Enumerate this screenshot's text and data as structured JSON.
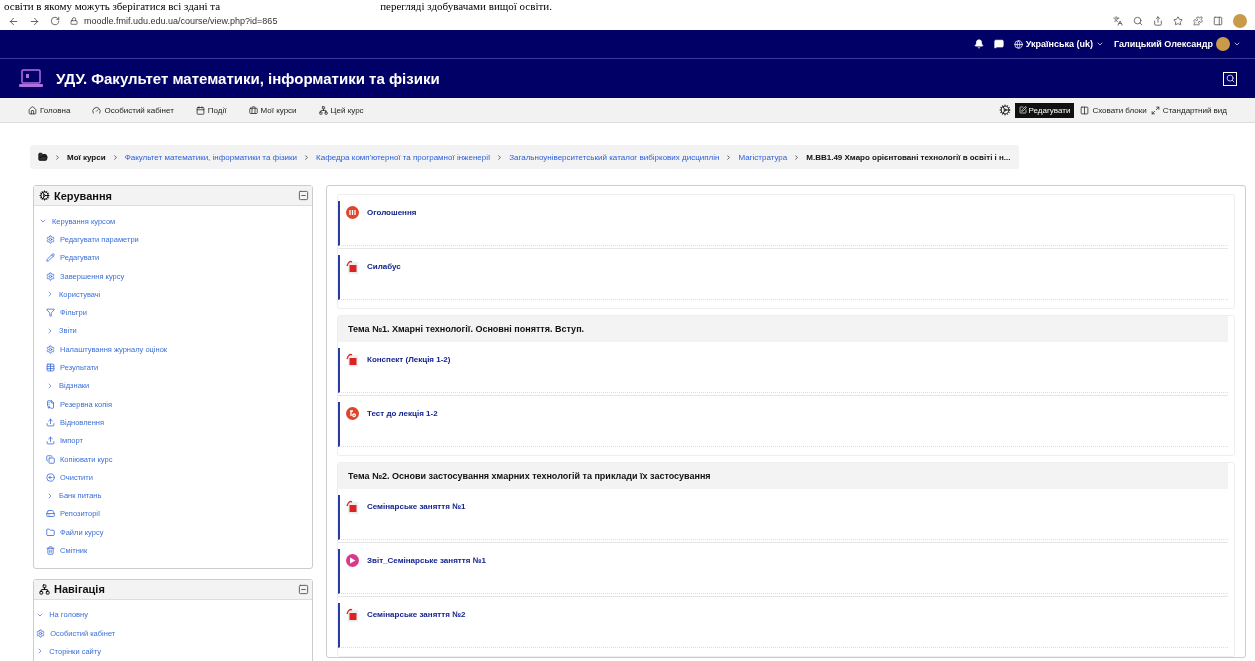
{
  "document_fragment": {
    "left": "освіти в якому можуть зберігатися всі здані та",
    "right": "перегляді здобувачами вищої освіти."
  },
  "browser": {
    "url": "moodle.fmif.udu.edu.ua/course/view.php?id=865"
  },
  "topbar": {
    "language": "Українська (uk)",
    "user": "Галицький Олександр"
  },
  "header": {
    "title": "УДУ. Факультет математики, інформатики та фізики"
  },
  "navbar": {
    "items": [
      "Головна",
      "Особистий кабінет",
      "Події",
      "Мої курси",
      "Цей курс"
    ],
    "edit_button": "Редагувати",
    "hide_blocks": "Сховати блоки",
    "standard_view": "Стандартний вид"
  },
  "breadcrumb": [
    {
      "label": "Мої курси",
      "kind": "text"
    },
    {
      "label": "Факультет математики, інформатики та фізики",
      "kind": "link"
    },
    {
      "label": "Кафедра комп'ютерної та програмної інженерії",
      "kind": "link"
    },
    {
      "label": "Загальноуніверситетський каталог вибіркових дисциплін",
      "kind": "link"
    },
    {
      "label": "Магістратура",
      "kind": "link"
    },
    {
      "label": "М.ВВ1.49 Хмаро орієнтовані технології в освіті і н...",
      "kind": "text"
    }
  ],
  "blocks": [
    {
      "title": "Керування",
      "items": [
        {
          "label": "Керування курсом",
          "kind": "group",
          "expanded": true,
          "children": [
            {
              "label": "Редагувати параметри",
              "kind": "link"
            },
            {
              "label": "Редагувати",
              "kind": "link"
            },
            {
              "label": "Завершення курсу",
              "kind": "link"
            },
            {
              "label": "Користувачі",
              "kind": "group",
              "expanded": false
            },
            {
              "label": "Фільтри",
              "kind": "link"
            },
            {
              "label": "Звіти",
              "kind": "group",
              "expanded": false
            },
            {
              "label": "Налаштування журналу оцінок",
              "kind": "link"
            },
            {
              "label": "Результати",
              "kind": "link"
            },
            {
              "label": "Відзнаки",
              "kind": "group",
              "expanded": false
            },
            {
              "label": "Резервна копія",
              "kind": "link"
            },
            {
              "label": "Відновлення",
              "kind": "link"
            },
            {
              "label": "Імпорт",
              "kind": "link"
            },
            {
              "label": "Копіювати курс",
              "kind": "link"
            },
            {
              "label": "Очистити",
              "kind": "link"
            },
            {
              "label": "Банк питань",
              "kind": "group",
              "expanded": false
            },
            {
              "label": "Репозиторії",
              "kind": "link"
            },
            {
              "label": "Файли курсу",
              "kind": "link"
            },
            {
              "label": "Смітник",
              "kind": "link"
            }
          ]
        }
      ]
    },
    {
      "title": "Навігація",
      "items": [
        {
          "label": "На головну",
          "kind": "group",
          "expanded": true
        },
        {
          "label": "Особистий кабінет",
          "kind": "link"
        },
        {
          "label": "Сторінки сайту",
          "kind": "group",
          "expanded": false
        }
      ]
    }
  ],
  "sections": [
    {
      "items": [
        {
          "title": "Оголошення",
          "kind": "forum"
        },
        {
          "title": "Силабус",
          "kind": "pdf"
        }
      ]
    },
    {
      "title": "Тема №1. Хмарні технології. Основні поняття. Вступ.",
      "items": [
        {
          "title": "Конспект (Лекція 1-2)",
          "kind": "pdf"
        },
        {
          "title": "Тест до лекція 1-2",
          "kind": "quiz"
        }
      ]
    },
    {
      "title": "Тема №2. Основи застосування хмарних технологій та приклади їх застосування",
      "items": [
        {
          "title": "Семінарське заняття №1",
          "kind": "pdf"
        },
        {
          "title": "Звіт_Семінарське заняття №1",
          "kind": "assign"
        },
        {
          "title": "Семінарське заняття №2",
          "kind": "pdf"
        }
      ]
    }
  ]
}
